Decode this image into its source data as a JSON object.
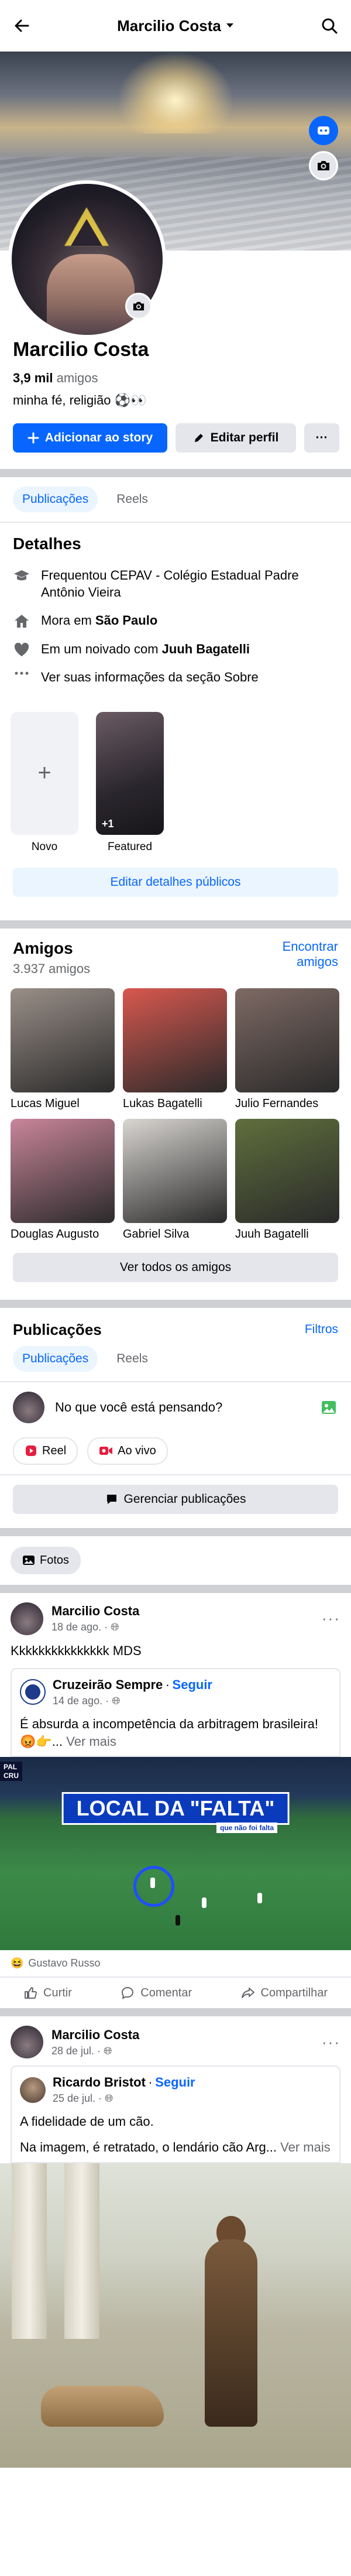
{
  "topbar": {
    "title": "Marcilio Costa"
  },
  "profile": {
    "name": "Marcilio Costa",
    "friends_count": "3,9 mil",
    "friends_word": "amigos",
    "bio": "minha fé, religião ⚽️👀",
    "add_story_label": "Adicionar ao story",
    "edit_profile_label": "Editar perfil",
    "more_label": "···"
  },
  "tabs": [
    "Publicações",
    "Reels"
  ],
  "details": {
    "title": "Detalhes",
    "items": [
      {
        "icon": "graduation-cap-icon",
        "text": "Frequentou CEPAV - Colégio Estadual Padre Antônio Vieira"
      },
      {
        "icon": "home-icon",
        "prefix": "Mora em ",
        "bold": "São Paulo"
      },
      {
        "icon": "heart-icon",
        "prefix": "Em um noivado com ",
        "bold": "Juuh Bagatelli"
      },
      {
        "icon": "dots-icon",
        "text": "Ver suas informações da seção Sobre"
      }
    ]
  },
  "featured": {
    "new_label": "Novo",
    "item_label": "Featured",
    "item_count": "+1",
    "edit_public_label": "Editar detalhes públicos"
  },
  "friends": {
    "title": "Amigos",
    "count": "3.937 amigos",
    "find_label": "Encontrar amigos",
    "see_all_label": "Ver todos os amigos",
    "list": [
      {
        "name": "Lucas Miguel",
        "color": "#9a8f88"
      },
      {
        "name": "Lukas Bagatelli",
        "color": "#d8584f"
      },
      {
        "name": "Julio Fernandes",
        "color": "#7e6a64"
      },
      {
        "name": "Douglas Augusto",
        "color": "#c9859a"
      },
      {
        "name": "Gabriel Silva",
        "color": "#d9d6d2"
      },
      {
        "name": "Juuh Bagatelli",
        "color": "#5f6f3c"
      }
    ]
  },
  "posts_section": {
    "title": "Publicações",
    "filters_label": "Filtros",
    "composer_placeholder": "No que você está pensando?",
    "reel_label": "Reel",
    "live_label": "Ao vivo",
    "manage_label": "Gerenciar publicações",
    "photos_label": "Fotos"
  },
  "posts": [
    {
      "author": "Marcilio Costa",
      "date": "18 de ago.",
      "text": "Kkkkkkkkkkkkkkk MDS",
      "shared": {
        "author": "Cruzeirão Sempre",
        "follow": "Seguir",
        "date": "14 de ago.",
        "text": "É absurda a incompetência da arbitragem brasileira! 😡👉...",
        "see_more": "Ver mais",
        "image_title": "LOCAL DA \"FALTA\"",
        "image_sub": "que não foi falta",
        "score_a": "PAL",
        "score_b": "CRU"
      },
      "reactions": "Gustavo Russo",
      "like_label": "Curtir",
      "comment_label": "Comentar",
      "share_label": "Compartilhar"
    },
    {
      "author": "Marcilio Costa",
      "date": "28 de jul.",
      "shared": {
        "author": "Ricardo Bristot",
        "follow": "Seguir",
        "date": "25 de jul.",
        "text_line1": "A fidelidade de um cão.",
        "text_line2": "Na imagem, é retratado, o lendário cão Arg...",
        "see_more": "Ver mais"
      }
    }
  ],
  "colors": {
    "brand": "#0866ff",
    "divider": "#ced0d4",
    "text_muted": "#65676b"
  }
}
